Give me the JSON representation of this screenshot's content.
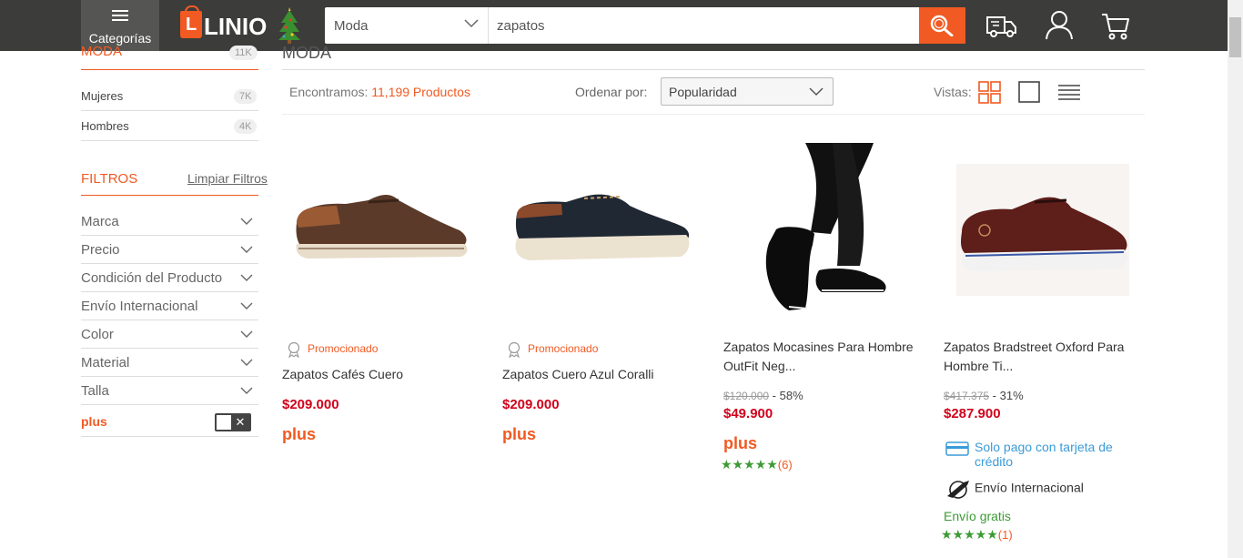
{
  "header": {
    "categories_label": "Categorías",
    "logo_text": "LINIO",
    "logo_bag_letter": "L",
    "search": {
      "category": "Moda",
      "query": "zapatos"
    }
  },
  "sidebar": {
    "section_title": "MODA",
    "section_count": "11K",
    "items": [
      {
        "label": "Mujeres",
        "count": "7K"
      },
      {
        "label": "Hombres",
        "count": "4K"
      }
    ],
    "filters_title": "FILTROS",
    "clear_filters": "Limpiar Filtros",
    "filters": [
      "Marca",
      "Precio",
      "Condición del Producto",
      "Envío Internacional",
      "Color",
      "Material",
      "Talla"
    ],
    "plus_label": "plus",
    "plus_toggle_mark": "✕"
  },
  "main": {
    "title": "MODA",
    "found_prefix": "Encontramos:",
    "found_count": "11,199 Productos",
    "sort_label": "Ordenar por:",
    "sort_value": "Popularidad",
    "views_label": "Vistas:"
  },
  "products": [
    {
      "promo": "Promocionado",
      "name": "Zapatos Cafés Cuero",
      "price": "$209.000",
      "plus": "plus"
    },
    {
      "promo": "Promocionado",
      "name": "Zapatos Cuero Azul Coralli",
      "price": "$209.000",
      "plus": "plus"
    },
    {
      "name_line1": "Zapatos Mocasines Para Hombre",
      "name_line2": "OutFit Neg...",
      "old_price": "$120.000",
      "discount": " - 58%",
      "price": "$49.900",
      "plus": "plus",
      "stars": "★★★★★",
      "reviews": "(6)"
    },
    {
      "name_line1": "Zapatos Bradstreet Oxford Para",
      "name_line2": "Hombre Ti...",
      "old_price": "$417.375",
      "discount": " - 31%",
      "price": "$287.900",
      "credit_line1": "Solo pago con tarjeta de",
      "credit_line2": "crédito",
      "international": "Envío Internacional",
      "free_shipping": "Envío gratis",
      "stars": "★★★★★",
      "reviews": "(1)"
    }
  ],
  "colors": {
    "brand_orange": "#f15a22",
    "header_dark": "#3c3c3b",
    "price_red": "#d0021b",
    "rating_green": "#3d9b35",
    "info_blue": "#3a9bd9"
  }
}
